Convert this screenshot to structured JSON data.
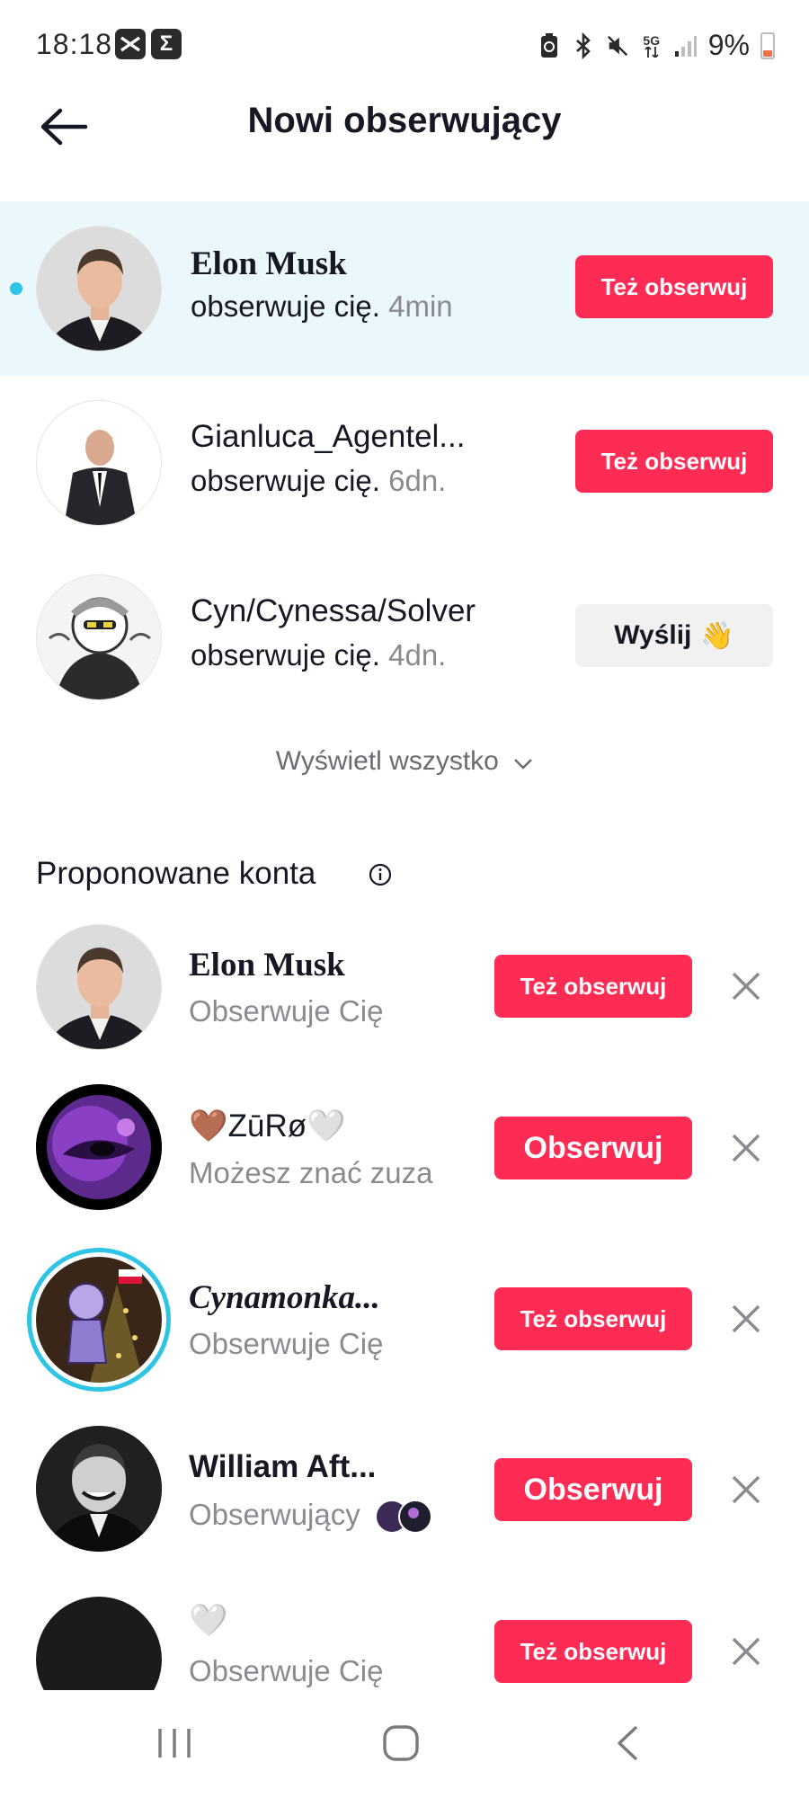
{
  "status_bar": {
    "time": "18:18",
    "app_icon_1": "capcut-icon",
    "app_icon_2": "Σ",
    "icons": [
      "battery-saver-icon",
      "bluetooth-icon",
      "mute-icon",
      "5g-icon",
      "signal-icon"
    ],
    "network_label": "5G",
    "battery": "9%"
  },
  "header": {
    "title": "Nowi obserwujący",
    "back_icon": "arrow-left-icon"
  },
  "new_followers": [
    {
      "name": "Elon Musk",
      "status": "obserwuje cię.",
      "time": "4min",
      "action": "Też obserwuj",
      "unread": true
    },
    {
      "name": "Gianluca_Agentel...",
      "status": "obserwuje cię.",
      "time": "6dn.",
      "action": "Też obserwuj",
      "unread": false
    },
    {
      "name": "Cyn/Cynessa/Solver",
      "status": "obserwuje cię.",
      "time": "4dn.",
      "action": "Wyślij",
      "action_emoji": "👋",
      "unread": false
    }
  ],
  "view_all": "Wyświetl wszystko",
  "suggested": {
    "title": "Proponowane konta",
    "accounts": [
      {
        "name": "Elon Musk",
        "subtitle": "Obserwuje Cię",
        "action": "Też obserwuj"
      },
      {
        "name": "ZūRø",
        "name_prefix_emoji": "🤎",
        "name_suffix_emoji": "🤍",
        "subtitle": "Możesz znać zuza",
        "action": "Obserwuj"
      },
      {
        "name": "Cynamonka...",
        "subtitle": "Obserwuje Cię",
        "action": "Też obserwuj"
      },
      {
        "name": "William Aft...",
        "subtitle": "Obserwujący",
        "action": "Obserwuj"
      },
      {
        "name": "🤍",
        "subtitle": "Obserwuje Cię",
        "action": "Też obserwuj"
      }
    ]
  },
  "colors": {
    "accent": "#fe2c55",
    "highlight_row": "#eaf7fb",
    "unread_dot": "#2ec4e6",
    "secondary_text": "#8a8b91"
  },
  "nav": {
    "recents_icon": "recents-icon",
    "home_icon": "home-icon",
    "back_icon": "back-icon"
  }
}
